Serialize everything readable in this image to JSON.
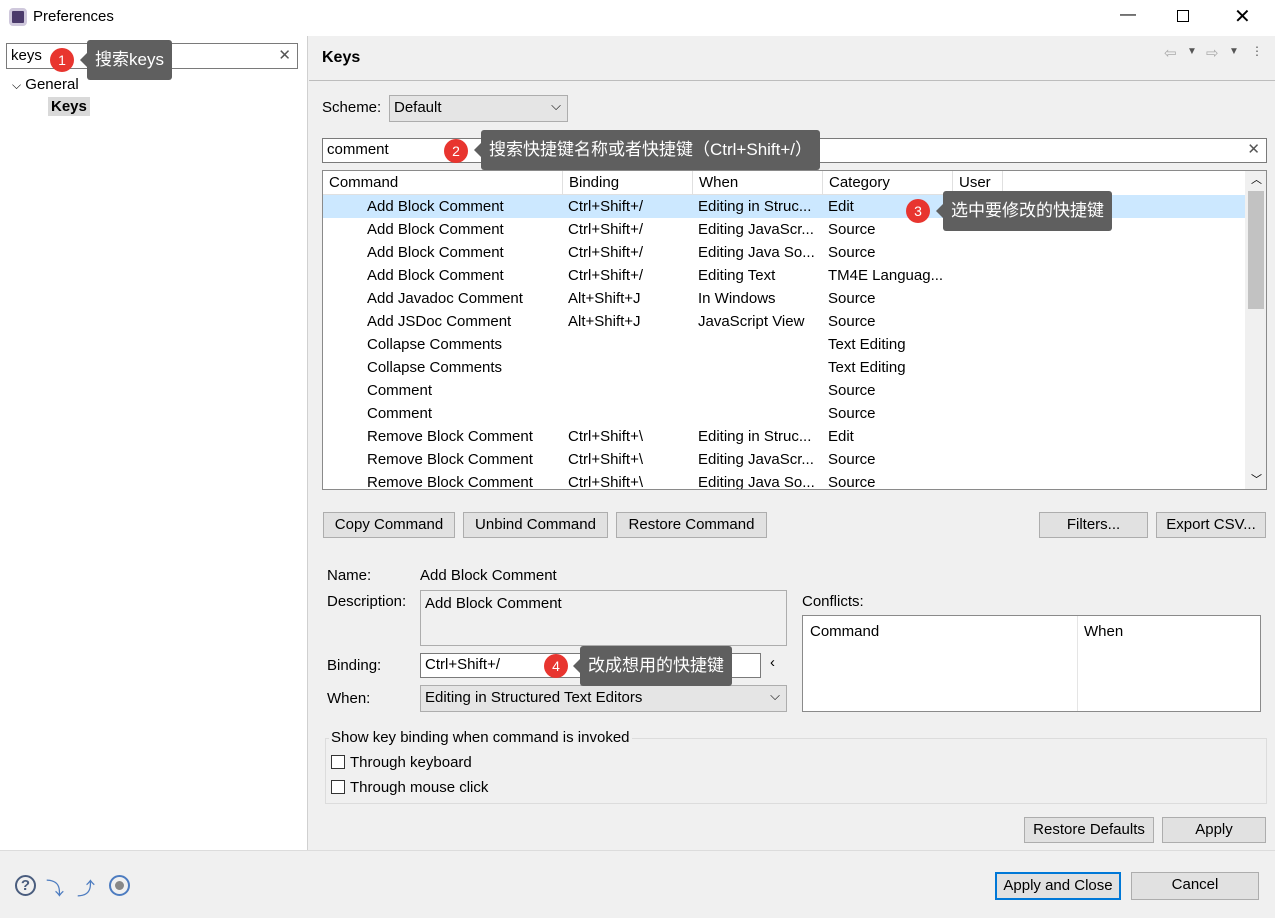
{
  "window": {
    "title": "Preferences",
    "icon": "eclipse-gear-icon"
  },
  "left": {
    "search_value": "keys",
    "tree": [
      {
        "label": "General",
        "expanded": true
      },
      {
        "label": "Keys",
        "selected": true
      }
    ]
  },
  "callouts": [
    {
      "num": "1",
      "text": "搜索keys"
    },
    {
      "num": "2",
      "text": "搜索快捷键名称或者快捷键（Ctrl+Shift+/）"
    },
    {
      "num": "3",
      "text": "选中要修改的快捷键"
    },
    {
      "num": "4",
      "text": "改成想用的快捷键"
    }
  ],
  "page": {
    "title": "Keys",
    "scheme_label": "Scheme:",
    "scheme_value": "Default",
    "filter_value": "comment"
  },
  "table": {
    "columns": [
      "Command",
      "Binding",
      "When",
      "Category",
      "User"
    ],
    "rows": [
      [
        "Add Block Comment",
        "Ctrl+Shift+/",
        "Editing in Struc...",
        "Edit",
        ""
      ],
      [
        "Add Block Comment",
        "Ctrl+Shift+/",
        "Editing JavaScr...",
        "Source",
        ""
      ],
      [
        "Add Block Comment",
        "Ctrl+Shift+/",
        "Editing Java So...",
        "Source",
        ""
      ],
      [
        "Add Block Comment",
        "Ctrl+Shift+/",
        "Editing Text",
        "TM4E Languag...",
        ""
      ],
      [
        "Add Javadoc Comment",
        "Alt+Shift+J",
        "In Windows",
        "Source",
        ""
      ],
      [
        "Add JSDoc Comment",
        "Alt+Shift+J",
        "JavaScript View",
        "Source",
        ""
      ],
      [
        "Collapse Comments",
        "",
        "",
        "Text Editing",
        ""
      ],
      [
        "Collapse Comments",
        "",
        "",
        "Text Editing",
        ""
      ],
      [
        "Comment",
        "",
        "",
        "Source",
        ""
      ],
      [
        "Comment",
        "",
        "",
        "Source",
        ""
      ],
      [
        "Remove Block Comment",
        "Ctrl+Shift+\\",
        "Editing in Struc...",
        "Edit",
        ""
      ],
      [
        "Remove Block Comment",
        "Ctrl+Shift+\\",
        "Editing JavaScr...",
        "Source",
        ""
      ],
      [
        "Remove Block Comment",
        "Ctrl+Shift+\\",
        "Editing Java So...",
        "Source",
        ""
      ]
    ]
  },
  "buttons": {
    "copy": "Copy Command",
    "unbind": "Unbind Command",
    "restore": "Restore Command",
    "filters": "Filters...",
    "export": "Export CSV...",
    "restore_defaults": "Restore Defaults",
    "apply": "Apply",
    "apply_close": "Apply and Close",
    "cancel": "Cancel"
  },
  "details": {
    "name_label": "Name:",
    "name_value": "Add Block Comment",
    "desc_label": "Description:",
    "desc_value": "Add Block Comment",
    "binding_label": "Binding:",
    "binding_value": "Ctrl+Shift+/",
    "when_label": "When:",
    "when_value": "Editing in Structured Text Editors",
    "conflicts_label": "Conflicts:",
    "conflict_cols": [
      "Command",
      "When"
    ]
  },
  "show_binding": {
    "title": "Show key binding when command is invoked",
    "keyboard": "Through keyboard",
    "mouse": "Through mouse click"
  }
}
